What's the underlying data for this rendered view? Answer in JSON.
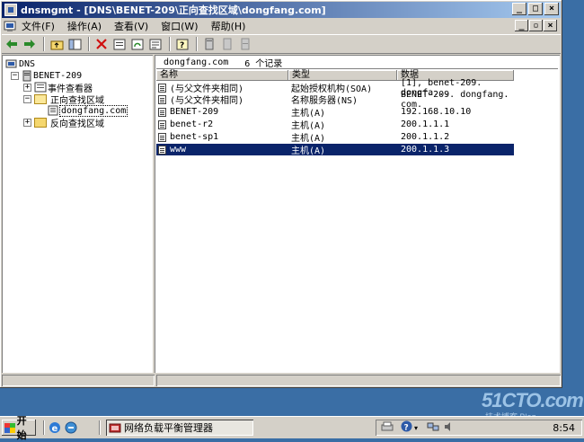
{
  "window": {
    "title": "dnsmgmt - [DNS\\BENET-209\\正向查找区域\\dongfang.com]",
    "min_glyph": "_",
    "max_glyph": "□",
    "close_glyph": "×"
  },
  "mdi": {
    "min_glyph": "_",
    "restore_glyph": "▫",
    "close_glyph": "×"
  },
  "menubar": {
    "items": [
      "文件(F)",
      "操作(A)",
      "查看(V)",
      "窗口(W)",
      "帮助(H)"
    ]
  },
  "toolbar": {
    "icons": [
      "back-arrow-icon",
      "forward-arrow-icon",
      "up-folder-icon",
      "show-hide-tree-icon",
      "delete-icon",
      "properties-icon",
      "refresh-icon",
      "export-icon",
      "help-icon",
      "server-icon",
      "server2-icon",
      "server3-icon"
    ]
  },
  "tree": {
    "root": "DNS",
    "server": "BENET-209",
    "event_viewer": "事件查看器",
    "forward_zones": "正向查找区域",
    "zone": "dongfang.com",
    "reverse_zones": "反向查找区域"
  },
  "rightpane": {
    "zone_name": "dongfang.com",
    "record_count": "6 个记录",
    "columns": [
      "名称",
      "类型",
      "数据"
    ],
    "rows": [
      {
        "name": "(与父文件夹相同)",
        "type": "起始授权机构(SOA)",
        "data": "[1], benet-209. dongfa..."
      },
      {
        "name": "(与父文件夹相同)",
        "type": "名称服务器(NS)",
        "data": "BENET-209. dongfang. com."
      },
      {
        "name": "BENET-209",
        "type": "主机(A)",
        "data": "192.168.10.10"
      },
      {
        "name": "benet-r2",
        "type": "主机(A)",
        "data": "200.1.1.1"
      },
      {
        "name": "benet-sp1",
        "type": "主机(A)",
        "data": "200.1.1.2"
      },
      {
        "name": "www",
        "type": "主机(A)",
        "data": "200.1.1.3"
      }
    ]
  },
  "taskbar": {
    "start_label": "开始",
    "task_label": "网络负载平衡管理器",
    "clock": "8:54"
  },
  "watermark": {
    "line1": "51CTO.com",
    "line2": "技术博客  Blog"
  }
}
